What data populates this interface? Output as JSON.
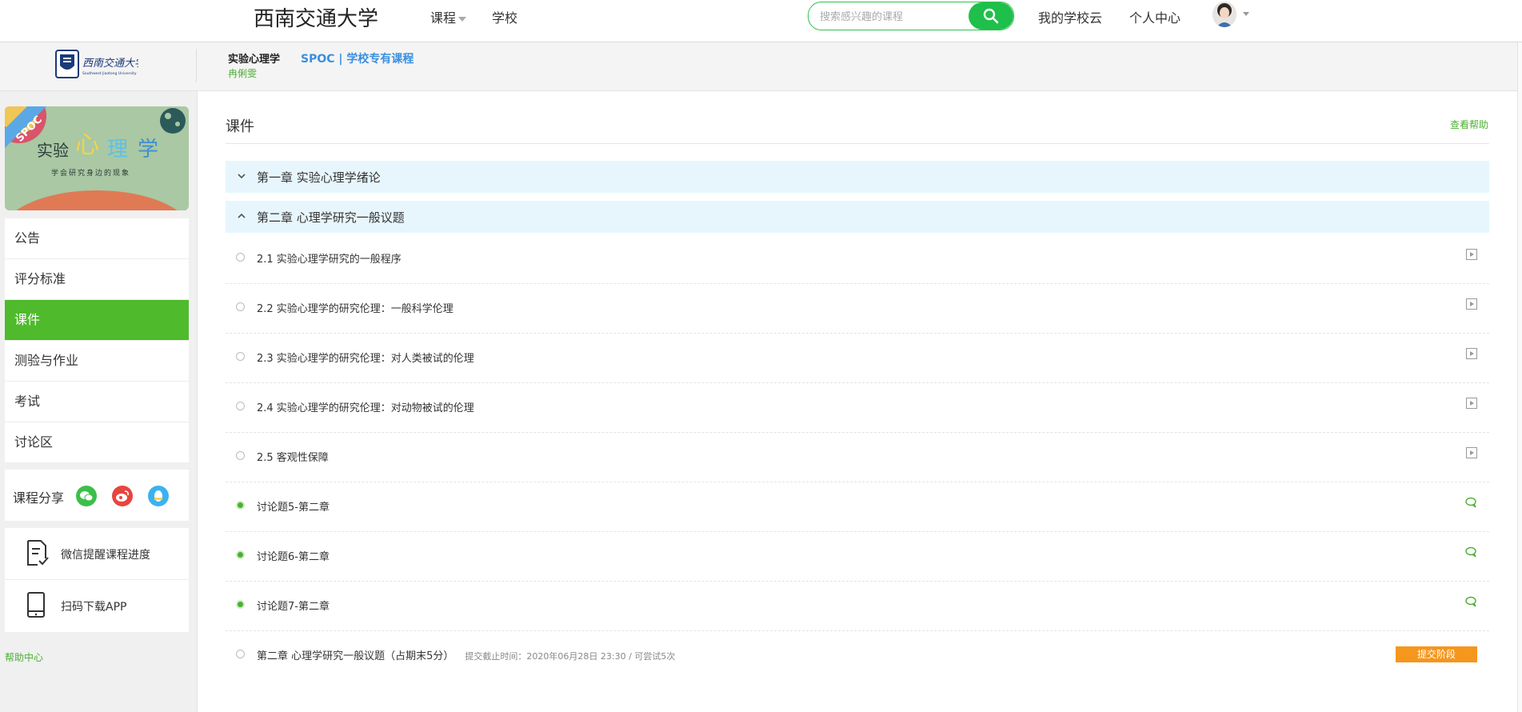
{
  "topbar": {
    "university_title": "西南交通大学",
    "nav_courses": "课程",
    "nav_school": "学校",
    "search_placeholder": "搜索感兴趣的课程",
    "my_school_cloud": "我的学校云",
    "personal_center": "个人中心"
  },
  "course_header": {
    "logo_text": "西南交通大学",
    "logo_subtext": "Southwest Jiaotong University",
    "course_name": "实验心理学",
    "course_type": "SPOC | 学校专有课程",
    "teacher": "冉俐雯"
  },
  "cover": {
    "badge": "SPOC",
    "title_part1": "实验",
    "title_part2": "心",
    "title_part3": "理",
    "title_part4": "学",
    "subtitle": "学会研究身边的现象"
  },
  "sidebar": {
    "items": [
      {
        "label": "公告",
        "active": false
      },
      {
        "label": "评分标准",
        "active": false
      },
      {
        "label": "课件",
        "active": true
      },
      {
        "label": "测验与作业",
        "active": false
      },
      {
        "label": "考试",
        "active": false
      },
      {
        "label": "讨论区",
        "active": false
      }
    ],
    "share_label": "课程分享",
    "share_icons": [
      "wechat-icon",
      "weibo-icon",
      "qq-icon"
    ],
    "wechat_remind": "微信提醒课程进度",
    "download_app": "扫码下载APP",
    "help_center": "帮助中心"
  },
  "main": {
    "title": "课件",
    "help_link": "查看帮助",
    "chapters": [
      {
        "label": "第一章 实验心理学绪论",
        "expanded": false
      },
      {
        "label": "第二章 心理学研究一般议题",
        "expanded": true
      }
    ],
    "lessons": [
      {
        "label": "2.1 实验心理学研究的一般程序",
        "status": "not-started",
        "icon": "video-icon"
      },
      {
        "label": "2.2 实验心理学的研究伦理：一般科学伦理",
        "status": "not-started",
        "icon": "video-icon"
      },
      {
        "label": "2.3 实验心理学的研究伦理：对人类被试的伦理",
        "status": "not-started",
        "icon": "video-icon"
      },
      {
        "label": "2.4 实验心理学的研究伦理：对动物被试的伦理",
        "status": "not-started",
        "icon": "video-icon"
      },
      {
        "label": "2.5 客观性保障",
        "status": "not-started",
        "icon": "video-icon"
      },
      {
        "label": "讨论题5-第二章",
        "status": "done",
        "icon": "discussion-icon"
      },
      {
        "label": "讨论题6-第二章",
        "status": "done",
        "icon": "discussion-icon"
      },
      {
        "label": "讨论题7-第二章",
        "status": "done",
        "icon": "discussion-icon"
      }
    ],
    "quiz": {
      "label": "第二章 心理学研究一般议题（占期末5分）",
      "deadline": "提交截止时间：2020年06月28日 23:30 / 可尝试5次",
      "button": "提交阶段"
    }
  },
  "colors": {
    "accent_green": "#4fba2c",
    "search_green": "#1fbf4b",
    "chapter_bg": "#e7f6fc",
    "submit_orange": "#f5961d",
    "course_type_blue": "#3a8fe0"
  }
}
